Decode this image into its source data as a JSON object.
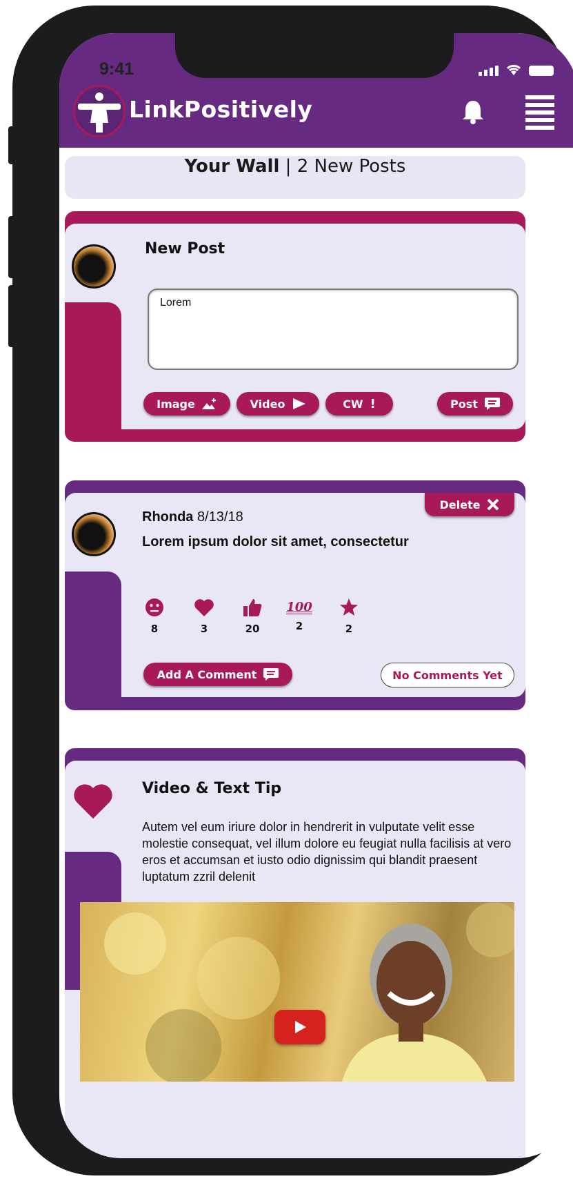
{
  "status_bar": {
    "time": "9:41"
  },
  "header": {
    "brand": "LinkPositively"
  },
  "wall": {
    "title": "Your Wall",
    "separator": "|",
    "subtitle": "2 New Posts"
  },
  "new_post": {
    "title": "New Post",
    "input_value": "Lorem",
    "buttons": {
      "image": "Image",
      "video": "Video",
      "cw": "CW",
      "post": "Post"
    }
  },
  "post": {
    "author": "Rhonda",
    "date": "8/13/18",
    "text": "Lorem ipsum dolor sit amet, consectetur",
    "delete_label": "Delete",
    "reactions": [
      {
        "icon": "smiley-icon",
        "count": "8"
      },
      {
        "icon": "heart-icon",
        "count": "3"
      },
      {
        "icon": "thumbs-up-icon",
        "count": "20"
      },
      {
        "icon": "hundred-icon",
        "count": "2"
      },
      {
        "icon": "star-icon",
        "count": "2"
      }
    ],
    "add_comment_label": "Add A Comment",
    "no_comments_label": "No Comments Yet"
  },
  "tip": {
    "title": "Video & Text Tip",
    "text": "Autem vel eum iriure dolor in hendrerit in vulputate velit esse molestie consequat, vel illum dolore eu feugiat nulla facilisis at vero eros et accumsan et iusto odio dignissim qui blandit praesent luptatum zzril delenit"
  },
  "colors": {
    "header": "#662a80",
    "accent": "#a8195a",
    "card_bg": "#e9e7f6",
    "wall_bar": "#e8e6f5"
  }
}
